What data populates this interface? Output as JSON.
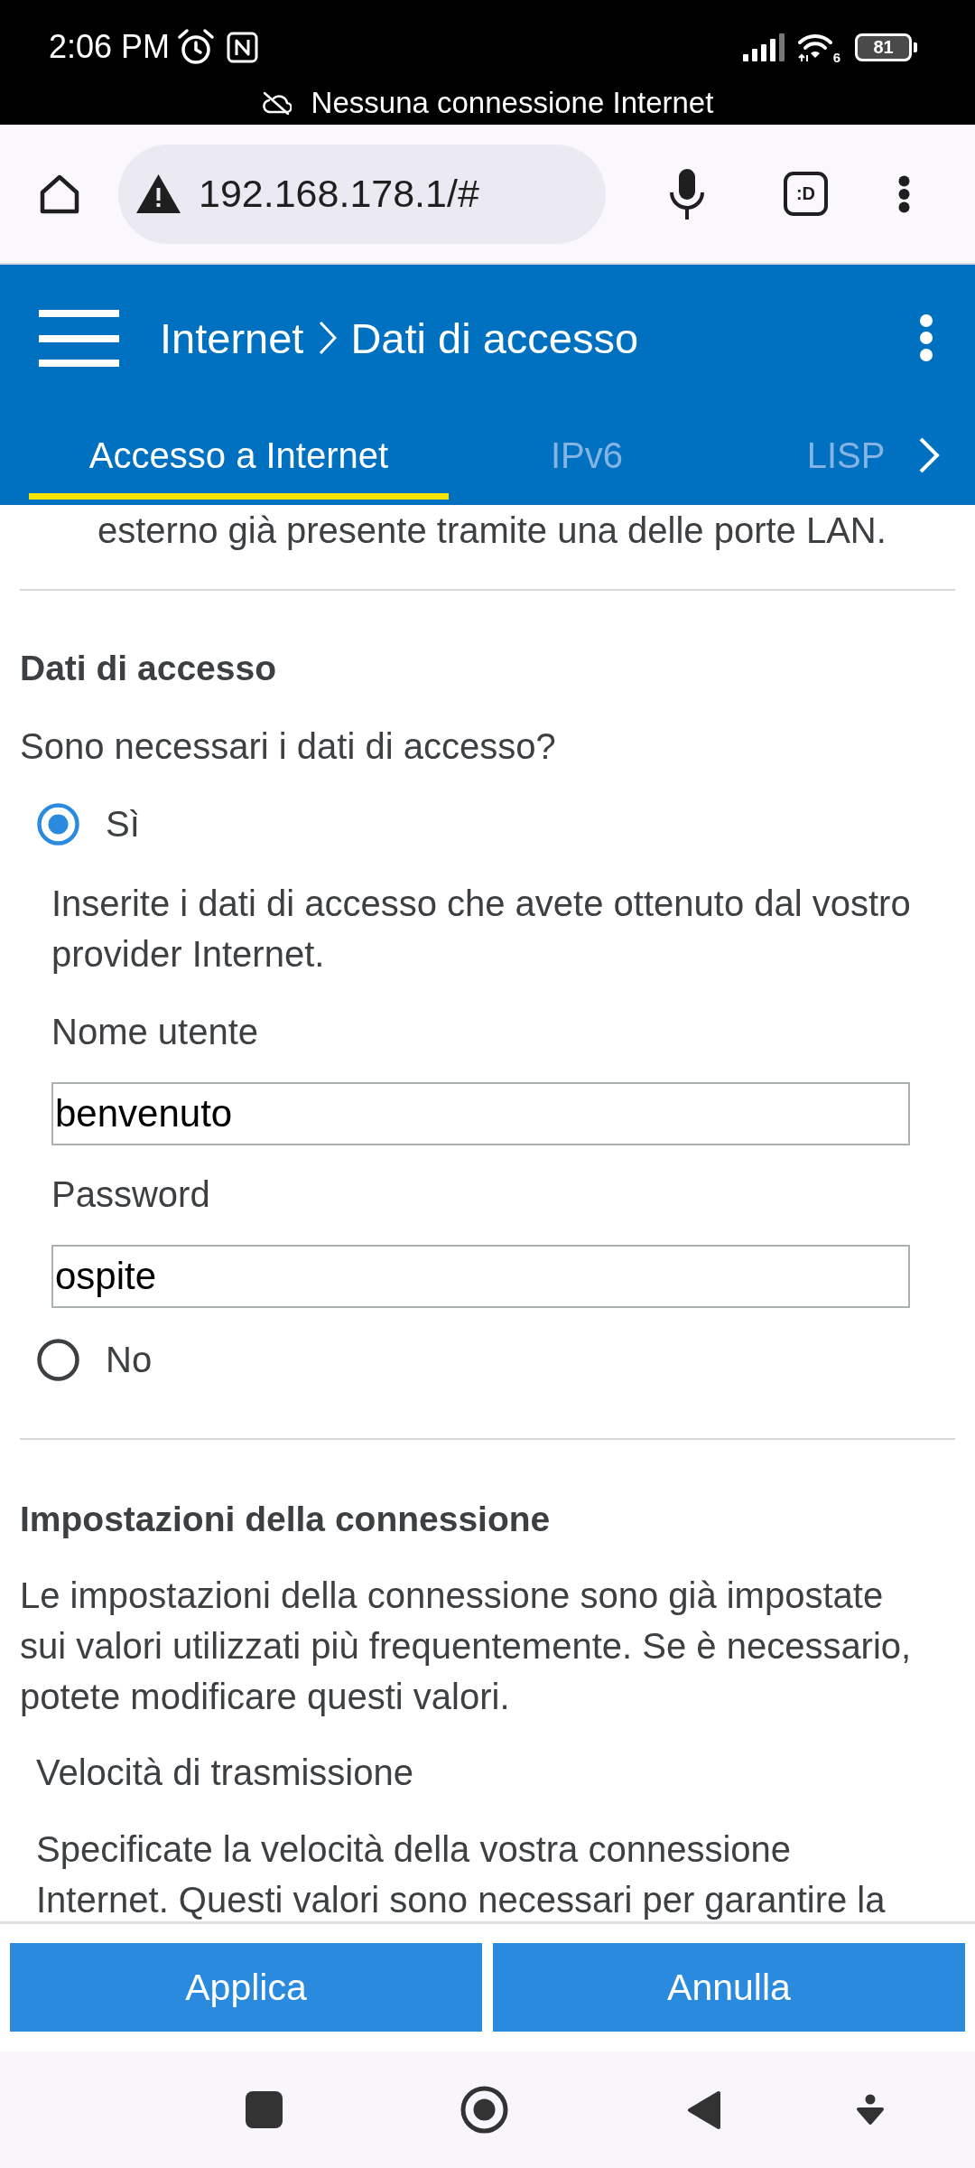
{
  "status_bar": {
    "time": "2:06 PM",
    "wifi_label": "6",
    "battery": "81",
    "notice": "Nessuna connessione Internet"
  },
  "browser_bar": {
    "url": "192.168.178.1/#",
    "tab_count": ":D"
  },
  "app_header": {
    "breadcrumb": [
      "Internet",
      "Dati di accesso"
    ],
    "tabs": [
      {
        "label": "Accesso a Internet",
        "selected": true
      },
      {
        "label": "IPv6",
        "selected": false
      },
      {
        "label": "LISP",
        "selected": false
      }
    ]
  },
  "intro_tail": "esterno già presente tramite una delle porte LAN.",
  "login_section": {
    "title": "Dati di accesso",
    "question": "Sono necessari i dati di accesso?",
    "options": [
      {
        "label": "Sì",
        "selected": true,
        "hint": "Inserite i dati di accesso che avete ottenuto dal vostro provider Internet.",
        "fields": [
          {
            "label": "Nome utente",
            "value": "benvenuto"
          },
          {
            "label": "Password",
            "value": "ospite"
          }
        ]
      },
      {
        "label": "No",
        "selected": false
      }
    ]
  },
  "connection_section": {
    "title": "Impostazioni della connessione",
    "description": "Le impostazioni della connessione sono già impostate sui valori utilizzati più frequentemente. Se è necessario, potete modificare questi valori.",
    "subsection": {
      "title": "Velocità di trasmissione",
      "description": "Specificate la velocità della vostra connessione Internet. Questi valori sono necessari per garantire la"
    }
  },
  "actions": [
    "Applica",
    "Annulla"
  ]
}
